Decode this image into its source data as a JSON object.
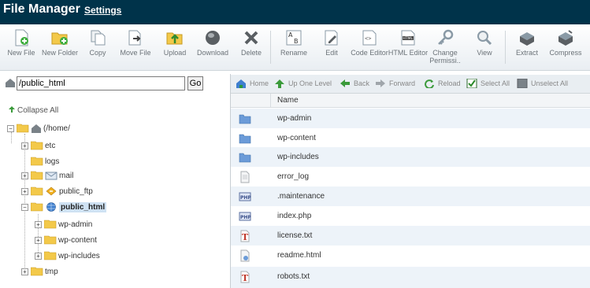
{
  "header": {
    "title": "File Manager",
    "settings_label": "Settings"
  },
  "toolbar": [
    {
      "label": "New File",
      "icon": "new-file-icon"
    },
    {
      "label": "New Folder",
      "icon": "new-folder-icon"
    },
    {
      "label": "Copy",
      "icon": "copy-icon"
    },
    {
      "label": "Move File",
      "icon": "move-file-icon"
    },
    {
      "label": "Upload",
      "icon": "upload-icon"
    },
    {
      "label": "Download",
      "icon": "download-icon"
    },
    {
      "label": "Delete",
      "icon": "delete-icon"
    },
    {
      "label": "Rename",
      "icon": "rename-icon"
    },
    {
      "label": "Edit",
      "icon": "edit-icon"
    },
    {
      "label": "Code Editor",
      "icon": "code-editor-icon"
    },
    {
      "label": "HTML Editor",
      "icon": "html-editor-icon"
    },
    {
      "label": "Change Permissi..",
      "icon": "change-permissions-icon"
    },
    {
      "label": "View",
      "icon": "view-icon"
    },
    {
      "label": "Extract",
      "icon": "extract-icon"
    },
    {
      "label": "Compress",
      "icon": "compress-icon"
    }
  ],
  "address": {
    "value": "/public_html",
    "go_label": "Go"
  },
  "tree": {
    "collapse_all_label": "Collapse All",
    "root_label": "(/home/",
    "items": [
      {
        "label": "etc",
        "icon": "folder-icon"
      },
      {
        "label": "logs",
        "icon": "folder-icon"
      },
      {
        "label": "mail",
        "icon": "mail-folder-icon"
      },
      {
        "label": "public_ftp",
        "icon": "ftp-folder-icon"
      },
      {
        "label": "public_html",
        "icon": "globe-folder-icon"
      },
      {
        "label": "wp-admin",
        "icon": "folder-icon"
      },
      {
        "label": "wp-content",
        "icon": "folder-icon"
      },
      {
        "label": "wp-includes",
        "icon": "folder-icon"
      },
      {
        "label": "tmp",
        "icon": "folder-icon"
      }
    ]
  },
  "nav": {
    "home": "Home",
    "up_one_level": "Up One Level",
    "back": "Back",
    "forward": "Forward",
    "reload": "Reload",
    "select_all": "Select All",
    "unselect_all": "Unselect All"
  },
  "table": {
    "header_name": "Name",
    "rows": [
      {
        "name": "wp-admin",
        "icon": "folder-icon"
      },
      {
        "name": "wp-content",
        "icon": "folder-icon"
      },
      {
        "name": "wp-includes",
        "icon": "folder-icon"
      },
      {
        "name": "error_log",
        "icon": "text-file-icon"
      },
      {
        "name": ".maintenance",
        "icon": "php-file-icon"
      },
      {
        "name": "index.php",
        "icon": "php-file-icon"
      },
      {
        "name": "license.txt",
        "icon": "txt-file-icon"
      },
      {
        "name": "readme.html",
        "icon": "html-file-icon"
      },
      {
        "name": "robots.txt",
        "icon": "txt-file-icon"
      }
    ]
  },
  "colors": {
    "header_bg": "#00334a",
    "selected_bg": "#cfe2f3",
    "row_alt": "#edf3f9"
  }
}
